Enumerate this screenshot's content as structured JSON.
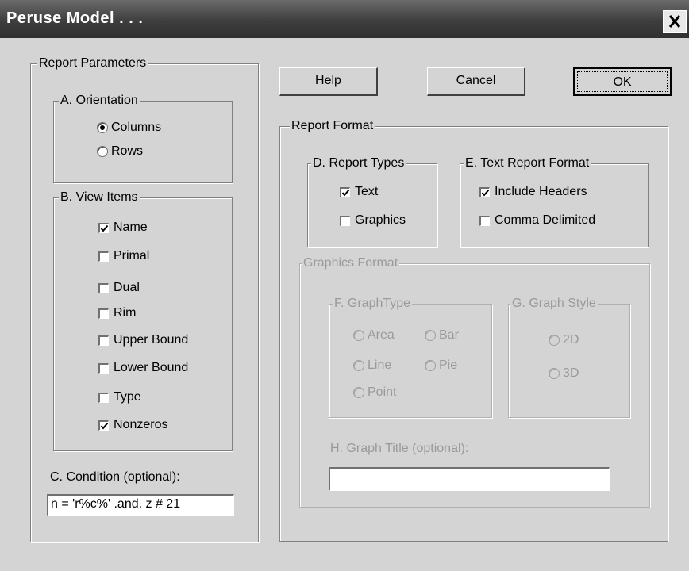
{
  "window": {
    "title": "Peruse Model . . .",
    "close_icon": "close-icon"
  },
  "buttons": {
    "help": "Help",
    "cancel": "Cancel",
    "ok": "OK"
  },
  "report_parameters": {
    "legend": "Report Parameters",
    "orientation": {
      "legend": "A. Orientation",
      "options": [
        {
          "label": "Columns",
          "selected": true
        },
        {
          "label": "Rows",
          "selected": false
        }
      ]
    },
    "view_items": {
      "legend": "B. View Items",
      "items": [
        {
          "label": "Name",
          "checked": true
        },
        {
          "label": "Primal",
          "checked": false
        },
        {
          "label": "Dual",
          "checked": false
        },
        {
          "label": "Rim",
          "checked": false
        },
        {
          "label": "Upper Bound",
          "checked": false
        },
        {
          "label": "Lower Bound",
          "checked": false
        },
        {
          "label": "Type",
          "checked": false
        },
        {
          "label": "Nonzeros",
          "checked": true
        }
      ]
    },
    "condition": {
      "label": "C. Condition (optional):",
      "value": "n = 'r%c%' .and. z # 21"
    }
  },
  "report_format": {
    "legend": "Report Format",
    "report_types": {
      "legend": "D. Report Types",
      "items": [
        {
          "label": "Text",
          "checked": true
        },
        {
          "label": "Graphics",
          "checked": false
        }
      ]
    },
    "text_format": {
      "legend": "E. Text Report Format",
      "items": [
        {
          "label": "Include Headers",
          "checked": true
        },
        {
          "label": "Comma Delimited",
          "checked": false
        }
      ]
    },
    "graphics_format": {
      "legend": "Graphics Format",
      "graph_type": {
        "legend": "F. GraphType",
        "options": [
          {
            "label": "Area"
          },
          {
            "label": "Bar"
          },
          {
            "label": "Line"
          },
          {
            "label": "Pie"
          },
          {
            "label": "Point"
          }
        ]
      },
      "graph_style": {
        "legend": "G. Graph Style",
        "options": [
          {
            "label": "2D"
          },
          {
            "label": "3D"
          }
        ]
      },
      "graph_title": {
        "label": "H. Graph Title (optional):",
        "value": ""
      }
    }
  }
}
